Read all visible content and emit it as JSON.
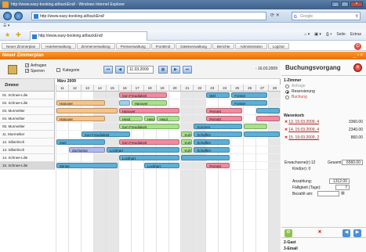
{
  "browser": {
    "title": "http://www.easy-booking.at/backEnd/ - Windows Internet Explorer",
    "url": "http://www.easy-booking.at/backEnd/",
    "search_placeholder": "Google",
    "tab_label": "http://www.easy-booking.at/backEnd/",
    "tools": [
      "Seite",
      "Extras"
    ]
  },
  "app_menu": [
    "Neuer Zimmerplan",
    "Hotelverwaltung",
    "Zimmerverwaltung",
    "Preisverwaltung",
    "FrontEnd",
    "Gästeverwaltung",
    "Berichte",
    "Administration",
    "LogOut"
  ],
  "panel_title": "Neuer Zimmerplan",
  "toolbar": {
    "opt_anfragen": "Anfragen",
    "opt_sperren": "Sperren",
    "opt_kategorie": "Kategorie",
    "date": "11.03.2009",
    "range_end": "- 16.03.2009"
  },
  "grid": {
    "rooms_header": "Zimmer",
    "month": "März 2009",
    "days": [
      "11",
      "12",
      "13",
      "14",
      "15",
      "16",
      "17",
      "18",
      "19",
      "20",
      "21",
      "22",
      "23",
      "24",
      "25",
      "26",
      "27",
      "28"
    ],
    "rooms": [
      "01. Schnee-Lilie",
      "02. Schnee-Lilie",
      "03. Murmeltier",
      "04. Murmeltier",
      "05. Murmeltier",
      "11. Murmeltier",
      "12. Silberlinch",
      "13. Silberlinch",
      "14. Schnee-Lilie",
      "15. Schnee-Lilie"
    ],
    "selected_room": 9
  },
  "bookings": [
    {
      "row": 0,
      "start": 5,
      "end": 9,
      "label": "Son Freudigkeit",
      "color": "#f28aa0"
    },
    {
      "row": 0,
      "start": 12,
      "end": 14,
      "label": "Wel",
      "color": "#5bb0d8"
    },
    {
      "row": 0,
      "start": 14,
      "end": 17,
      "label": "Forster",
      "color": "#5bb0d8"
    },
    {
      "row": 1,
      "start": 0,
      "end": 4,
      "label": "Hanover",
      "color": "#f6c48a"
    },
    {
      "row": 1,
      "start": 5,
      "end": 6,
      "label": "",
      "color": "#9ad1ef"
    },
    {
      "row": 1,
      "start": 6,
      "end": 9,
      "label": "Hanover",
      "color": "#a7e28a"
    },
    {
      "row": 1,
      "start": 14,
      "end": 17,
      "label": "Forster",
      "color": "#5bb0d8"
    },
    {
      "row": 2,
      "start": 0,
      "end": 5,
      "label": "",
      "color": "#f6c48a"
    },
    {
      "row": 2,
      "start": 5,
      "end": 10,
      "label": "Hanover",
      "color": "#f28aa0"
    },
    {
      "row": 2,
      "start": 12,
      "end": 15,
      "label": "Pernett",
      "color": "#f28aa0"
    },
    {
      "row": 2,
      "start": 16,
      "end": 18,
      "label": "",
      "color": "#5bb0d8"
    },
    {
      "row": 3,
      "start": 0,
      "end": 4,
      "label": "Hanover",
      "color": "#f6c48a"
    },
    {
      "row": 3,
      "start": 5,
      "end": 7,
      "label": "Heigl",
      "color": "#a7e28a"
    },
    {
      "row": 3,
      "start": 7,
      "end": 8,
      "label": "Heigl",
      "color": "#a7e28a"
    },
    {
      "row": 3,
      "start": 8,
      "end": 10,
      "label": "Heigl",
      "color": "#a7e28a"
    },
    {
      "row": 3,
      "start": 12,
      "end": 15,
      "label": "Pernett",
      "color": "#f28aa0"
    },
    {
      "row": 3,
      "start": 16,
      "end": 18,
      "label": "",
      "color": "#f28aa0"
    },
    {
      "row": 4,
      "start": 5,
      "end": 10,
      "label": "Son Freudigkeit",
      "color": "#a7e28a"
    },
    {
      "row": 4,
      "start": 11,
      "end": 15,
      "label": "Sommer",
      "color": "#5bb0d8"
    },
    {
      "row": 4,
      "start": 15,
      "end": 17,
      "label": "",
      "color": "#a7e28a"
    },
    {
      "row": 5,
      "start": 2,
      "end": 6,
      "label": "Son Freudigkeit",
      "color": "#5bb0d8"
    },
    {
      "row": 5,
      "start": 10,
      "end": 11,
      "label": "Kuhn",
      "color": "#a7e28a"
    },
    {
      "row": 5,
      "start": 11,
      "end": 15,
      "label": "Schaffen",
      "color": "#5bb0d8"
    },
    {
      "row": 5,
      "start": 15,
      "end": 18,
      "label": "",
      "color": "#5bb0d8"
    },
    {
      "row": 6,
      "start": 0,
      "end": 4,
      "label": "eger",
      "color": "#5bb0d8"
    },
    {
      "row": 6,
      "start": 5,
      "end": 10,
      "label": "Son Freudigkeit",
      "color": "#f28aa0"
    },
    {
      "row": 6,
      "start": 10,
      "end": 11,
      "label": "Kuhn",
      "color": "#a7e28a"
    },
    {
      "row": 6,
      "start": 11,
      "end": 14,
      "label": "Schaffen",
      "color": "#5bb0d8"
    },
    {
      "row": 7,
      "start": 1,
      "end": 4,
      "label": "Zacharias",
      "color": "#b0b8ee"
    },
    {
      "row": 7,
      "start": 4,
      "end": 10,
      "label": "Lockhart",
      "color": "#5bb0d8"
    },
    {
      "row": 7,
      "start": 10,
      "end": 11,
      "label": "Kuhn",
      "color": "#a7e28a"
    },
    {
      "row": 7,
      "start": 11,
      "end": 14,
      "label": "Schaffen",
      "color": "#5bb0d8"
    },
    {
      "row": 8,
      "start": 5,
      "end": 10,
      "label": "Lockhart",
      "color": "#5bb0d8"
    },
    {
      "row": 8,
      "start": 10,
      "end": 14,
      "label": "",
      "color": "#5bb0d8"
    },
    {
      "row": 9,
      "start": 0,
      "end": 5,
      "label": "Winter",
      "color": "#5bb0d8"
    },
    {
      "row": 9,
      "start": 7,
      "end": 10,
      "label": "Lockhart",
      "color": "#5bb0d8"
    },
    {
      "row": 9,
      "start": 12,
      "end": 14,
      "label": "Pernett",
      "color": "#f28aa0"
    }
  ],
  "sidebar": {
    "title": "Buchungsvorgang",
    "section_room": "1-Zimmer",
    "options": [
      "Anfrage",
      "Reservierung",
      "Buchung"
    ],
    "selected_option": 1,
    "cart_title": "Warenkorb",
    "cart": [
      {
        "date": "13. 15.03.2009, 4",
        "price": "3360.00"
      },
      {
        "date": "14. 15.03.2009, 4",
        "price": "2340.00"
      },
      {
        "date": "15. 19.03.2009, 2",
        "price": "860.00"
      }
    ],
    "adults_label": "Erwachsene(r):12",
    "total_label": "Gesamt",
    "total": "6560.00",
    "children_label": "Kind(er): 0",
    "deposit_label": "Anzahlung:",
    "deposit": "1312.00",
    "due_label": "Fälligkeit (Tage):",
    "due": "7",
    "paid_label": "Bezahlt am:",
    "footer_guest": "2-Gast",
    "footer_email": "3-Email"
  }
}
